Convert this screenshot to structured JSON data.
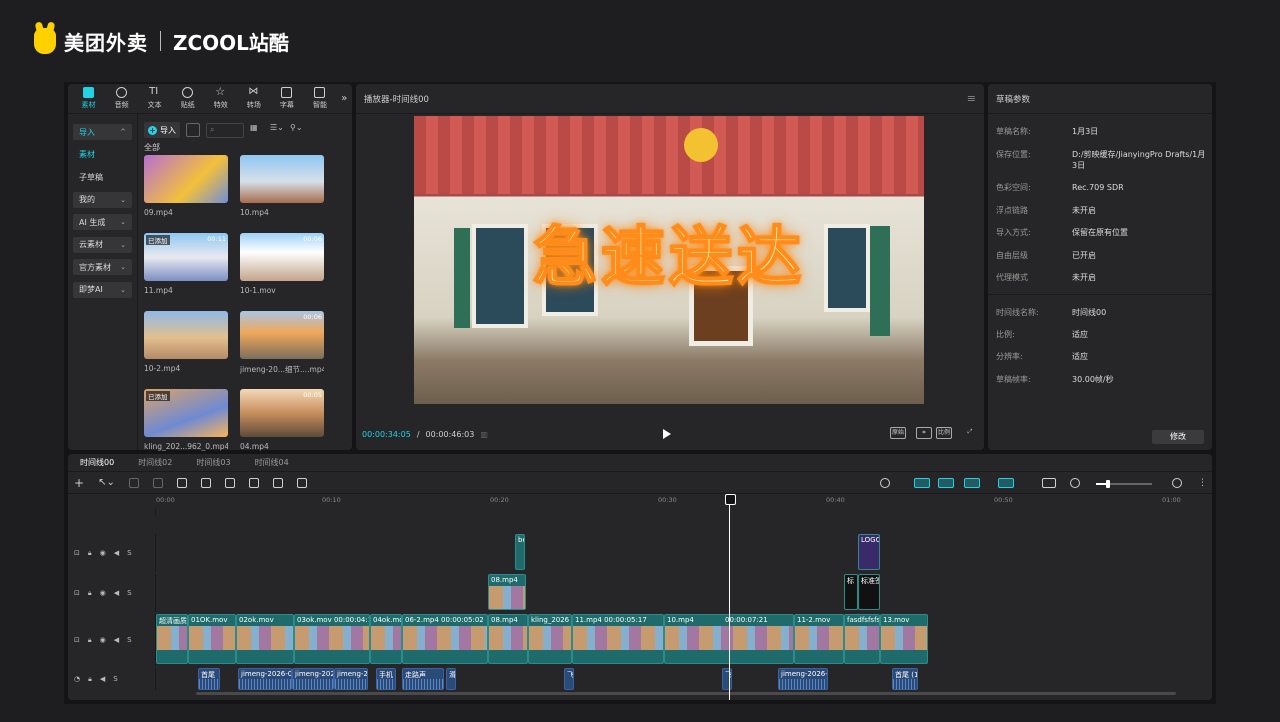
{
  "brand": {
    "meituan": "美团外卖",
    "zcool": "ZCOOL站酷"
  },
  "media_panel": {
    "tabs": [
      "素材",
      "音频",
      "文本",
      "贴纸",
      "特效",
      "转场",
      "字幕",
      "智能"
    ],
    "sidebar": [
      {
        "label": "导入",
        "type": "box"
      },
      {
        "label": "素材",
        "type": "sel"
      },
      {
        "label": "子草稿",
        "type": "plain"
      },
      {
        "label": "我的",
        "type": "box"
      },
      {
        "label": "AI 生成",
        "type": "box"
      },
      {
        "label": "云素材",
        "type": "box"
      },
      {
        "label": "官方素材",
        "type": "box"
      },
      {
        "label": "即梦AI",
        "type": "box"
      }
    ],
    "import_label": "导入",
    "all_label": "全部",
    "thumbnails": [
      {
        "name": "09.mp4",
        "badge": "",
        "duration": ""
      },
      {
        "name": "10.mp4",
        "badge": "",
        "duration": ""
      },
      {
        "name": "11.mp4",
        "badge": "已添加",
        "duration": "00:11"
      },
      {
        "name": "10-1.mov",
        "badge": "",
        "duration": "00:06"
      },
      {
        "name": "10-2.mp4",
        "badge": "",
        "duration": ""
      },
      {
        "name": "jimeng-20...细节....mp4",
        "badge": "",
        "duration": "00:06"
      },
      {
        "name": "kling_202...962_0.mp4",
        "badge": "已添加",
        "duration": ""
      },
      {
        "name": "04.mp4",
        "badge": "",
        "duration": "00:05"
      }
    ]
  },
  "player": {
    "title": "播放器-时间线00",
    "overlay_text": "急速送达",
    "current_time": "00:00:34:05",
    "total_time": "00:00:46:03",
    "buttons": [
      "原始",
      "比例"
    ]
  },
  "draft": {
    "title": "草稿参数",
    "rows_a": [
      {
        "k": "草稿名称:",
        "v": "1月3日"
      },
      {
        "k": "保存位置:",
        "v": "D:/剪映缓存/JianyingPro Drafts/1月3日"
      },
      {
        "k": "色彩空间:",
        "v": "Rec.709 SDR"
      },
      {
        "k": "浮点链路",
        "v": "未开启"
      },
      {
        "k": "导入方式:",
        "v": "保留在原有位置"
      },
      {
        "k": "自由层级",
        "v": "已开启"
      },
      {
        "k": "代理模式",
        "v": "未开启"
      }
    ],
    "rows_b": [
      {
        "k": "时间线名称:",
        "v": "时间线00"
      },
      {
        "k": "比例:",
        "v": "适应"
      },
      {
        "k": "分辨率:",
        "v": "适应"
      },
      {
        "k": "草稿帧率:",
        "v": "30.00帧/秒"
      }
    ],
    "modify_label": "修改"
  },
  "timeline": {
    "tabs": [
      "时间线00",
      "时间线02",
      "时间线03",
      "时间线04"
    ],
    "ruler": [
      "00:00",
      "00:10",
      "00:20",
      "00:30",
      "00:40",
      "00:50",
      "01:00"
    ],
    "main_clips": [
      "超清画质",
      "01OK.mov",
      "02ok.mov",
      "03ok.mov  00:00:04:1",
      "04ok.mo",
      "06-2.mp4  00:00:05:02",
      "08.mp4",
      "kling_2026",
      "11.mp4  00:00:05:17",
      "10.mp4",
      "00:00:07:21",
      "11-2.mov",
      "fasdfsfsfs",
      "13.mov"
    ],
    "overlay_clips": [
      "08.mp4",
      "标",
      "标准签"
    ],
    "upper_clips": [
      "be",
      "LOGO"
    ],
    "audio_clips": [
      "首尾",
      "jimeng-2026-0",
      "jimeng-202",
      "jimeng-2",
      "手机",
      "走路声",
      "滑",
      "飞",
      "飞",
      "jimeng-2026-0",
      "首尾 (1"
    ]
  }
}
